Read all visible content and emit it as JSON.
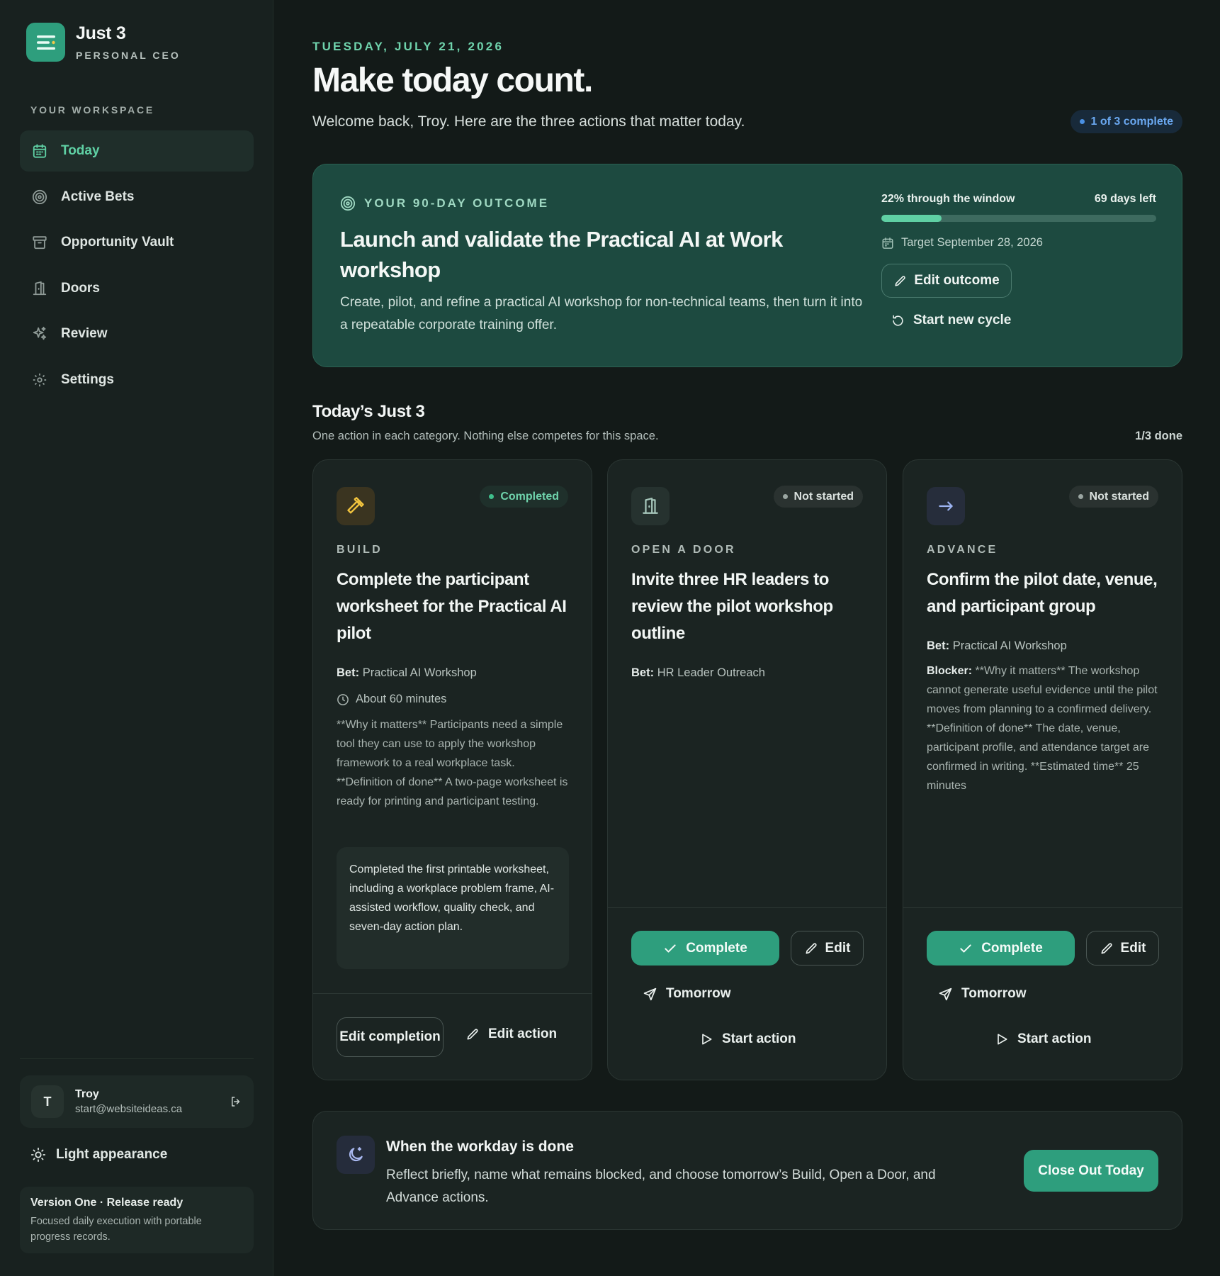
{
  "app": {
    "title": "Just 3",
    "subtitle": "PERSONAL CEO"
  },
  "sidebar": {
    "section_label": "YOUR WORKSPACE",
    "items": [
      {
        "label": "Today",
        "icon": "calendar-icon",
        "active": true
      },
      {
        "label": "Active Bets",
        "icon": "target-icon",
        "active": false
      },
      {
        "label": "Opportunity Vault",
        "icon": "archive-icon",
        "active": false
      },
      {
        "label": "Doors",
        "icon": "door-icon",
        "active": false
      },
      {
        "label": "Review",
        "icon": "sparkles-icon",
        "active": false
      },
      {
        "label": "Settings",
        "icon": "gear-icon",
        "active": false
      }
    ],
    "user": {
      "initial": "T",
      "name": "Troy",
      "email": "start@websiteideas.ca"
    },
    "appearance_label": "Light appearance",
    "version": {
      "title": "Version One · Release ready",
      "text": "Focused daily execution with portable progress records."
    }
  },
  "header": {
    "date": "TUESDAY, JULY 21, 2026",
    "headline": "Make today count.",
    "welcome": "Welcome back, Troy. Here are the three actions that matter today.",
    "complete_pill": "1 of 3 complete"
  },
  "outcome": {
    "label": "YOUR 90-DAY OUTCOME",
    "title": "Launch and validate the Practical AI at Work workshop",
    "description": "Create, pilot, and refine a practical AI workshop for non-technical teams, then turn it into a repeatable corporate training offer.",
    "progress_label": "22% through the window",
    "progress_fraction": 0.22,
    "days_left": "69 days left",
    "target": "Target September 28, 2026",
    "edit_button": "Edit outcome",
    "new_cycle_button": "Start new cycle"
  },
  "today": {
    "title": "Today’s Just 3",
    "subtitle": "One action in each category. Nothing else competes for this space.",
    "count": "1/3 done"
  },
  "cards": [
    {
      "category": "BUILD",
      "status": "Completed",
      "title": "Complete the participant worksheet for the Practical AI pilot",
      "bet_label": "Bet:",
      "bet": "Practical AI Workshop",
      "duration": "About 60 minutes",
      "body": "**Why it matters** Participants need a simple tool they can use to apply the workshop framework to a real workplace task. **Definition of done** A two-page worksheet is ready for printing and participant testing.",
      "note": "Completed the first printable worksheet, including a workplace problem frame, AI-assisted workflow, quality check, and seven-day action plan.",
      "edit_completion": "Edit completion",
      "edit_action": "Edit action"
    },
    {
      "category": "OPEN A DOOR",
      "status": "Not started",
      "title": "Invite three HR leaders to review the pilot workshop outline",
      "bet_label": "Bet:",
      "bet": "HR Leader Outreach",
      "complete": "Complete",
      "edit": "Edit",
      "tomorrow": "Tomorrow",
      "start": "Start action"
    },
    {
      "category": "ADVANCE",
      "status": "Not started",
      "title": "Confirm the pilot date, venue, and participant group",
      "bet_label": "Bet:",
      "bet": "Practical AI Workshop",
      "blocker_label": "Blocker:",
      "blocker": "**Why it matters** The workshop cannot generate useful evidence until the pilot moves from planning to a confirmed delivery. **Definition of done** The date, venue, participant profile, and attendance target are confirmed in writing. **Estimated time** 25 minutes",
      "complete": "Complete",
      "edit": "Edit",
      "tomorrow": "Tomorrow",
      "start": "Start action"
    }
  ],
  "closeout": {
    "title": "When the workday is done",
    "text": "Reflect briefly, name what remains blocked, and choose tomorrow’s Build, Open a Door, and Advance actions.",
    "button": "Close Out Today"
  },
  "colors": {
    "accent": "#2e9e7d",
    "accent_text": "#5fd0a4",
    "background": "#131a18",
    "outcome_bg": "#1d4a40"
  }
}
